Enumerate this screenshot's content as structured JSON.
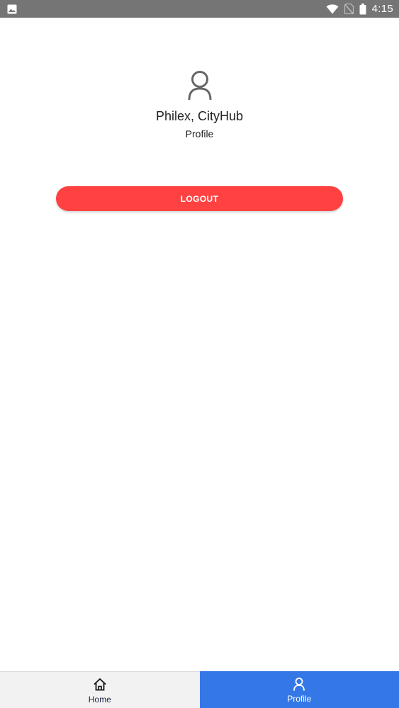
{
  "status_bar": {
    "time": "4:15",
    "icons": [
      "image-icon",
      "wifi-icon",
      "no-sim-icon",
      "battery-icon"
    ]
  },
  "profile": {
    "icon": "user-icon",
    "name": "Philex, CityHub",
    "subtitle": "Profile"
  },
  "logout": {
    "label": "LOGOUT",
    "color": "#ff4141"
  },
  "bottom_nav": {
    "tabs": [
      {
        "label": "Home",
        "icon": "home-icon",
        "active": false
      },
      {
        "label": "Profile",
        "icon": "user-icon",
        "active": true
      }
    ],
    "active_color": "#3478e8"
  }
}
